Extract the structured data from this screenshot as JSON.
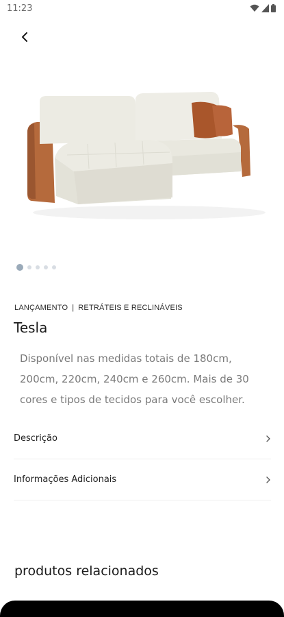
{
  "status_bar": {
    "time": "11:23",
    "icons": [
      "wifi-icon",
      "signal-icon",
      "battery-icon"
    ]
  },
  "back_button": {
    "icon": "chevron-left-icon"
  },
  "carousel": {
    "total": 5,
    "active_index": 0
  },
  "product": {
    "category": "LANÇAMENTO",
    "separator": "|",
    "subcategory": "RETRÁTEIS E RECLINÁVEIS",
    "name": "Tesla",
    "description": "Disponível nas medidas totais de 180cm, 200cm, 220cm, 240cm e 260cm. Mais de 30 cores e tipos de tecidos para você escolher."
  },
  "sections": [
    {
      "label": "Descrição"
    },
    {
      "label": "Informações Adicionais"
    }
  ],
  "related": {
    "title": "produtos relacionados"
  }
}
